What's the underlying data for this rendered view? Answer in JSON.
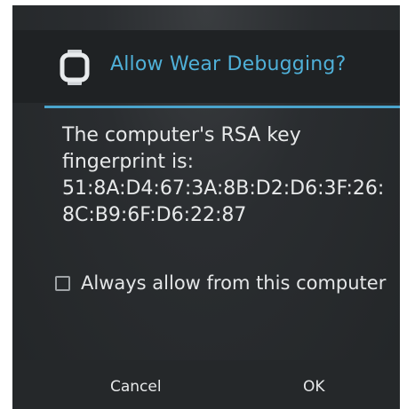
{
  "dialog": {
    "icon": "watch-icon",
    "title": "Allow Wear Debugging?",
    "body_lines": [
      "The computer's RSA key",
      "fingerprint is:",
      "51:8A:D4:67:3A:8B:D2:D6:3F:26:",
      "8C:B9:6F:D6:22:87"
    ],
    "checkbox": {
      "label": "Always allow from this computer",
      "checked": false
    },
    "buttons": {
      "cancel_label": "Cancel",
      "ok_label": "OK"
    }
  },
  "colors": {
    "accent": "#4fb0d8",
    "background": "#232628",
    "text": "#e7e9ea"
  }
}
